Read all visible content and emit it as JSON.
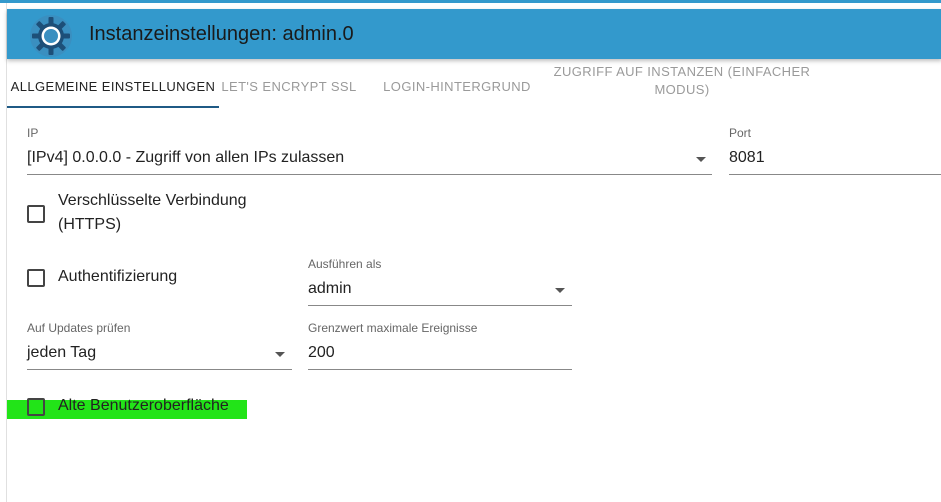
{
  "header": {
    "title": "Instanzeinstellungen: admin.0",
    "logo_icon": "gear-icon"
  },
  "tabs": [
    {
      "label": "ALLGEMEINE EINSTELLUNGEN",
      "active": true
    },
    {
      "label": "LET'S ENCRYPT SSL",
      "active": false
    },
    {
      "label": "LOGIN-HINTERGRUND",
      "active": false
    },
    {
      "label": "ZUGRIFF AUF INSTANZEN (EINFACHER MODUS)",
      "active": false
    }
  ],
  "form": {
    "ip": {
      "label": "IP",
      "value": "[IPv4] 0.0.0.0 - Zugriff von allen IPs zulassen"
    },
    "port": {
      "label": "Port",
      "value": "8081"
    },
    "https": {
      "label": "Verschlüsselte Verbindung (HTTPS)",
      "checked": false
    },
    "auth": {
      "label": "Authentifizierung",
      "checked": false
    },
    "run_as": {
      "label": "Ausführen als",
      "value": "admin"
    },
    "updates": {
      "label": "Auf Updates prüfen",
      "value": "jeden Tag"
    },
    "max_events": {
      "label": "Grenzwert maximale Ereignisse",
      "value": "200"
    },
    "old_ui": {
      "label": "Alte Benutzeroberfläche",
      "checked": false
    }
  },
  "colors": {
    "header": "#3399cc",
    "tab_indicator": "#1f5a85",
    "highlight": "#22e418"
  }
}
